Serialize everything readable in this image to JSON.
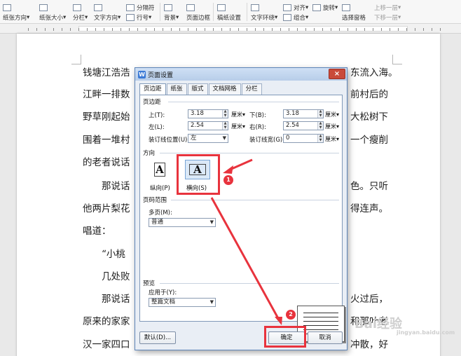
{
  "toolbar": {
    "paper_direction": "纸张方向",
    "paper_size": "纸张大小",
    "columns": "分栏",
    "text_direction": "文字方向",
    "page_break": "分隔符",
    "line_number": "行号",
    "background": "背景",
    "page_border": "页面边框",
    "manuscript": "稿纸设置",
    "wrap": "文字环绕",
    "align": "对齐",
    "rotate": "旋转",
    "group": "组合",
    "selection_pane": "选择窗格",
    "bring_forward": "上移一层",
    "send_backward": "下移一层"
  },
  "document": {
    "lines": [
      "钱塘江浩浩",
      "江畔一排数",
      "野草刚起始",
      "围着一堆村",
      "的老者说话",
      "那说话",
      "他两片梨花",
      "唱道：",
      "“小桃",
      "几处败",
      "那说话",
      "原来的家家",
      "汉一家四口"
    ],
    "right_fragments": [
      "东流入海。",
      "前村后的",
      "大松树下",
      "一个瘦削",
      "色。只听",
      "得连声。",
      "火过后，",
      "和那叶老",
      "冲散，好"
    ]
  },
  "dialog": {
    "title": "页面设置",
    "close": "×",
    "tabs": [
      "页边距",
      "纸张",
      "版式",
      "文档网格",
      "分栏"
    ],
    "margins": {
      "group": "页边距",
      "top_label": "上(T):",
      "top_value": "3.18",
      "bottom_label": "下(B):",
      "bottom_value": "3.18",
      "left_label": "左(L):",
      "left_value": "2.54",
      "right_label": "右(R):",
      "right_value": "2.54",
      "unit": "厘米",
      "gutter_pos_label": "装订线位置(U):",
      "gutter_pos_value": "左",
      "gutter_label": "装订线宽(G):",
      "gutter_value": "0"
    },
    "orientation": {
      "group": "方向",
      "portrait": "纵向(P)",
      "landscape": "横向(S)",
      "icon_letter": "A"
    },
    "pages": {
      "group": "页码范围",
      "multi_label": "多页(M):",
      "multi_value": "普通"
    },
    "preview": {
      "group": "预览",
      "apply_label": "应用于(Y):",
      "apply_value": "整篇文档"
    },
    "buttons": {
      "default": "默认(D)...",
      "ok": "确定",
      "cancel": "取消"
    }
  },
  "annotations": {
    "step1": "1",
    "step2": "2",
    "color": "#e8333d"
  },
  "watermark": {
    "brand": "Bai经验",
    "url": "jingyan.baidu.com"
  }
}
